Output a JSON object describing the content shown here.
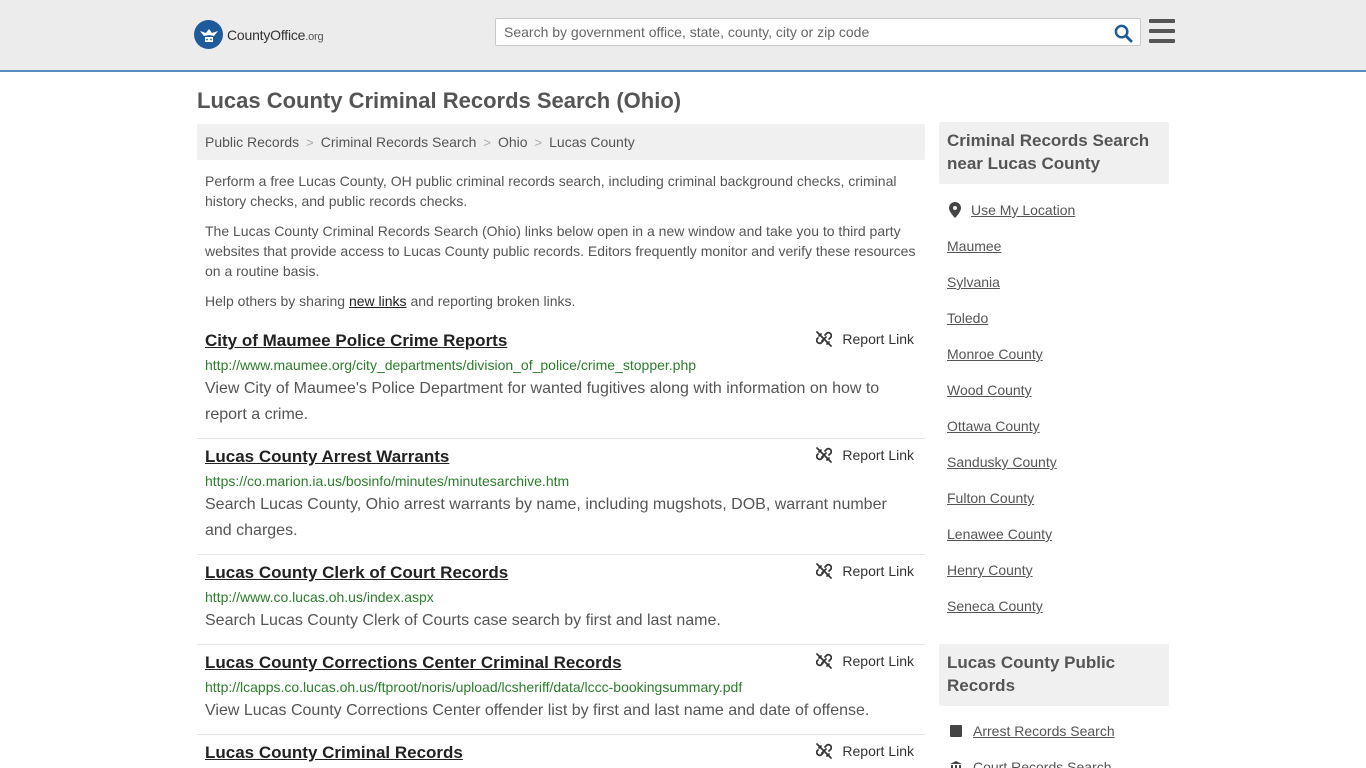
{
  "header": {
    "logo_text": "CountyOffice",
    "logo_tld": ".org",
    "search_placeholder": "Search by government office, state, county, city or zip code"
  },
  "page_title": "Lucas County Criminal Records Search (Ohio)",
  "breadcrumb": [
    "Public Records",
    "Criminal Records Search",
    "Ohio",
    "Lucas County"
  ],
  "intro": {
    "p1": "Perform a free Lucas County, OH public criminal records search, including criminal background checks, criminal history checks, and public records checks.",
    "p2": "The Lucas County Criminal Records Search (Ohio) links below open in a new window and take you to third party websites that provide access to Lucas County public records. Editors frequently monitor and verify these resources on a routine basis.",
    "p3_before": "Help others by sharing ",
    "p3_link": "new links",
    "p3_after": " and reporting broken links."
  },
  "report_label": "Report Link",
  "results": [
    {
      "title": "City of Maumee Police Crime Reports",
      "url": "http://www.maumee.org/city_departments/division_of_police/crime_stopper.php",
      "desc": "View City of Maumee's Police Department for wanted fugitives along with information on how to report a crime."
    },
    {
      "title": "Lucas County Arrest Warrants",
      "url": "https://co.marion.ia.us/bosinfo/minutes/minutesarchive.htm",
      "desc": "Search Lucas County, Ohio arrest warrants by name, including mugshots, DOB, warrant number and charges."
    },
    {
      "title": "Lucas County Clerk of Court Records",
      "url": "http://www.co.lucas.oh.us/index.aspx",
      "desc": "Search Lucas County Clerk of Courts case search by first and last name."
    },
    {
      "title": "Lucas County Corrections Center Criminal Records",
      "url": "http://lcapps.co.lucas.oh.us/ftproot/noris/upload/lcsheriff/data/lccc-bookingsummary.pdf",
      "desc": "View Lucas County Corrections Center offender list by first and last name and date of offense."
    },
    {
      "title": "Lucas County Criminal Records",
      "url": "",
      "desc": ""
    }
  ],
  "sidebar": {
    "nearby_title": "Criminal Records Search near Lucas County",
    "use_location": "Use My Location",
    "nearby": [
      "Maumee",
      "Sylvania",
      "Toledo",
      "Monroe County",
      "Wood County",
      "Ottawa County",
      "Sandusky County",
      "Fulton County",
      "Lenawee County",
      "Henry County",
      "Seneca County"
    ],
    "public_title": "Lucas County Public Records",
    "public_links": [
      "Arrest Records Search",
      "Court Records Search"
    ]
  },
  "colors": {
    "header_bg": "#ececec",
    "header_border": "#5a8fc4",
    "url_green": "#2c7d2c",
    "logo_blue": "#1f5b9a",
    "search_icon_blue": "#1f5b9a"
  }
}
